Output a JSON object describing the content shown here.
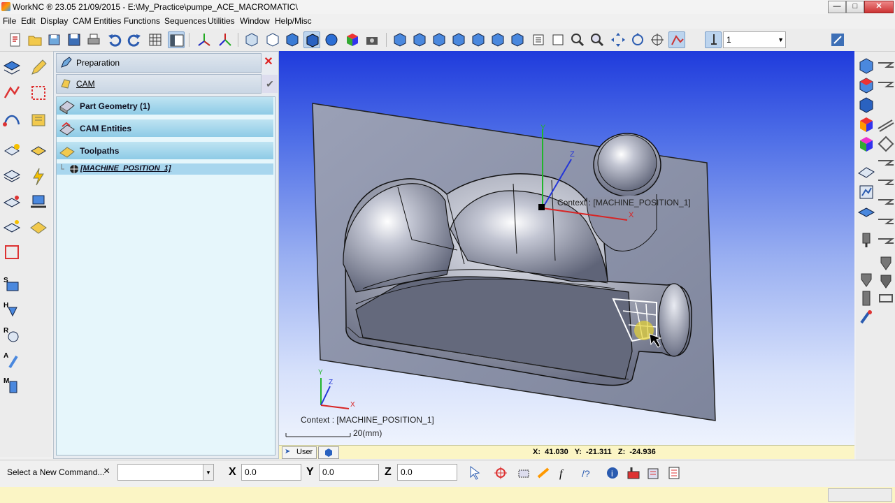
{
  "window": {
    "title": "WorkNC ® 23.05   21/09/2015 - E:\\My_Practice\\pumpe_ACE_MACROMATIC\\",
    "min_label": "—",
    "max_label": "□",
    "close_label": "✕"
  },
  "menu": [
    "File",
    "Edit",
    "Display",
    "CAM Entities",
    "Functions",
    "Sequences",
    "Utilities",
    "Window",
    "Help/Misc"
  ],
  "toolbar": {
    "view_value": "1",
    "minus_label": "-",
    "plus_label": "+"
  },
  "panel": {
    "preparation_label": "Preparation",
    "cam_label": "CAM",
    "tree": [
      {
        "label": "Part Geometry (1)",
        "icon": "part-geometry-icon"
      },
      {
        "label": "CAM Entities",
        "icon": "cam-entities-icon"
      },
      {
        "label": "Toolpaths",
        "icon": "toolpaths-icon"
      }
    ],
    "machine_position": "[MACHINE_POSITION_1]"
  },
  "viewport": {
    "context_label": "Context : [MACHINE_POSITION_1]",
    "axis_x": "X",
    "axis_y": "Y",
    "axis_z": "Z",
    "scale_label": "20(mm)",
    "user_tab": "User",
    "coords": "X:  41.030   Y:  -21.311   Z:  -24.936"
  },
  "command": {
    "prompt": "Select a New Command...",
    "close": "×",
    "x_label": "X",
    "y_label": "Y",
    "z_label": "Z",
    "x_value": "0.0",
    "y_value": "0.0",
    "z_value": "0.0"
  },
  "colors": {
    "viewport_top": "#1f3bdc",
    "viewport_bottom": "#eef3fd",
    "tree_row": "#a6d7ec",
    "status": "#fbf5c5"
  }
}
